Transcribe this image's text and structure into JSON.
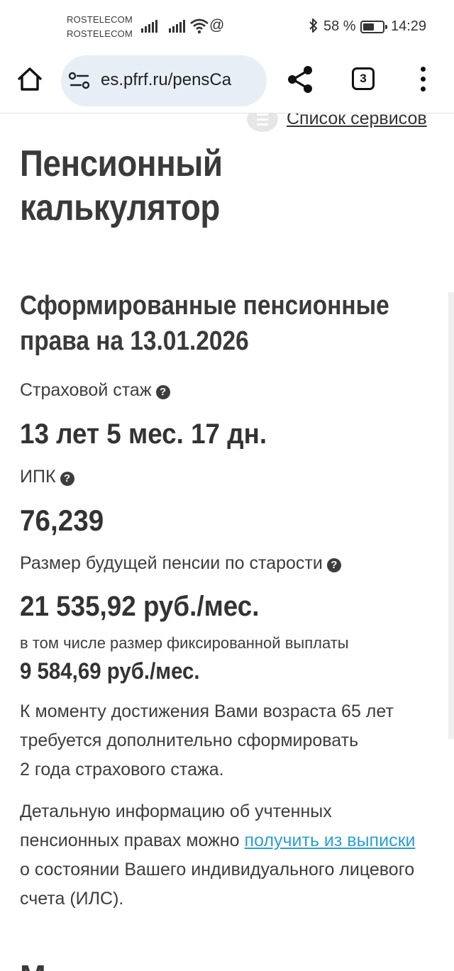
{
  "status_bar": {
    "carrier_1": "ROSTELECOM",
    "carrier_2": "ROSTELECOM",
    "extra_icon": "@",
    "bluetooth_icon": "bluetooth-icon",
    "battery_percent": "58 %",
    "battery_level": 0.58,
    "time": "14:29"
  },
  "browser": {
    "url": "es.pfrf.ru/pensCa",
    "tab_count": "3",
    "icons": [
      "home-icon",
      "site-settings-icon",
      "share-icon",
      "tabs-icon",
      "more-menu-icon"
    ]
  },
  "page": {
    "services_link": "Список сервисов",
    "title": "Пенсионный калькулятор",
    "section_title": "Сформированные пенсионные права на 13.01.2026",
    "insurance_label": "Страховой стаж",
    "insurance_value": "13 лет 5 мес. 17 дн.",
    "ipk_label": "ИПК",
    "ipk_value": "76,239",
    "pension_label": "Размер будущей пенсии по старости",
    "pension_value": "21 535,92 руб./мес.",
    "fixed_label": "в том числе размер фиксированной выплаты",
    "fixed_value": "9 584,69 руб./мес.",
    "note_line1": "К моменту достижения Вами возраста 65 лет",
    "note_line2": "требуется дополнительно сформировать",
    "note_line3": "2 года страхового стажа.",
    "detail_part1": "Детальную информацию об учтенных пенсионных правах можно",
    "detail_link": "получить из выписки",
    "detail_part2": "о состоянии Вашего индивидуального лицевого счета (ИЛС).",
    "help_icon": "question-circle-icon",
    "next_heading_start": "М"
  }
}
